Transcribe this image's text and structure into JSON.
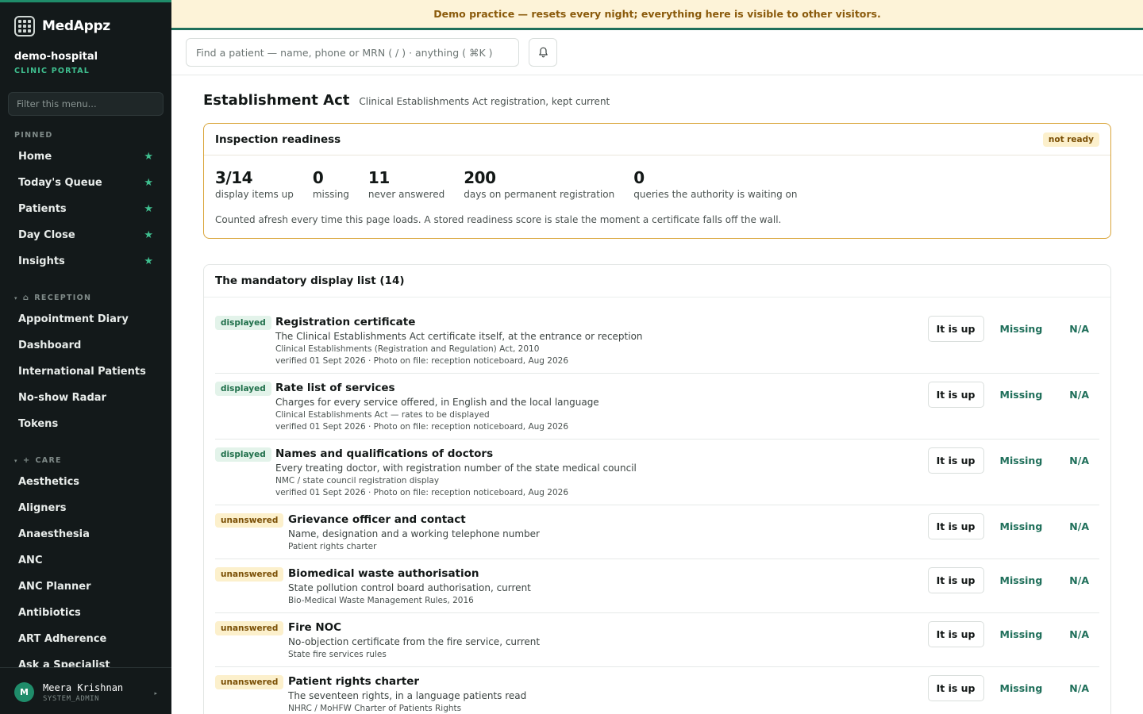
{
  "app": {
    "name": "MedAppz",
    "tenant": "demo-hospital",
    "portal": "CLINIC PORTAL"
  },
  "banner": "Demo practice — resets every night; everything here is visible to other visitors.",
  "sidebar": {
    "filter_placeholder": "Filter this menu...",
    "pinned_label": "PINNED",
    "pinned": [
      {
        "label": "Home"
      },
      {
        "label": "Today's Queue"
      },
      {
        "label": "Patients"
      },
      {
        "label": "Day Close"
      },
      {
        "label": "Insights"
      }
    ],
    "reception_label": "RECEPTION",
    "reception": [
      {
        "label": "Appointment Diary"
      },
      {
        "label": "Dashboard"
      },
      {
        "label": "International Patients"
      },
      {
        "label": "No-show Radar"
      },
      {
        "label": "Tokens"
      }
    ],
    "care_label": "CARE",
    "care": [
      {
        "label": "Aesthetics"
      },
      {
        "label": "Aligners"
      },
      {
        "label": "Anaesthesia"
      },
      {
        "label": "ANC"
      },
      {
        "label": "ANC Planner"
      },
      {
        "label": "Antibiotics"
      },
      {
        "label": "ART Adherence"
      },
      {
        "label": "Ask a Specialist"
      }
    ],
    "user": {
      "initial": "M",
      "name": "Meera Krishnan",
      "role": "SYSTEM_ADMIN"
    }
  },
  "topbar": {
    "search_placeholder": "Find a patient — name, phone or MRN ( / ) · anything ( ⌘K )"
  },
  "page": {
    "title": "Establishment Act",
    "subtitle": "Clinical Establishments Act registration, kept current"
  },
  "readiness": {
    "title": "Inspection readiness",
    "badge": "not ready",
    "stats": [
      {
        "value": "3/14",
        "label": "display items up"
      },
      {
        "value": "0",
        "label": "missing"
      },
      {
        "value": "11",
        "label": "never answered"
      },
      {
        "value": "200",
        "label": "days on permanent registration"
      },
      {
        "value": "0",
        "label": "queries the authority is waiting on"
      }
    ],
    "note": "Counted afresh every time this page loads. A stored readiness score is stale the moment a certificate falls off the wall."
  },
  "list": {
    "title": "The mandatory display list (14)",
    "actions": {
      "up": "It is up",
      "missing": "Missing",
      "na": "N/A"
    },
    "items": [
      {
        "status": "displayed",
        "title": "Registration certificate",
        "desc": "The Clinical Establishments Act certificate itself, at the entrance or reception",
        "law": "Clinical Establishments (Registration and Regulation) Act, 2010",
        "verified": "verified 01 Sept 2026 · Photo on file: reception noticeboard, Aug 2026"
      },
      {
        "status": "displayed",
        "title": "Rate list of services",
        "desc": "Charges for every service offered, in English and the local language",
        "law": "Clinical Establishments Act — rates to be displayed",
        "verified": "verified 01 Sept 2026 · Photo on file: reception noticeboard, Aug 2026"
      },
      {
        "status": "displayed",
        "title": "Names and qualifications of doctors",
        "desc": "Every treating doctor, with registration number of the state medical council",
        "law": "NMC / state council registration display",
        "verified": "verified 01 Sept 2026 · Photo on file: reception noticeboard, Aug 2026"
      },
      {
        "status": "unanswered",
        "title": "Grievance officer and contact",
        "desc": "Name, designation and a working telephone number",
        "law": "Patient rights charter",
        "verified": ""
      },
      {
        "status": "unanswered",
        "title": "Biomedical waste authorisation",
        "desc": "State pollution control board authorisation, current",
        "law": "Bio-Medical Waste Management Rules, 2016",
        "verified": ""
      },
      {
        "status": "unanswered",
        "title": "Fire NOC",
        "desc": "No-objection certificate from the fire service, current",
        "law": "State fire services rules",
        "verified": ""
      },
      {
        "status": "unanswered",
        "title": "Patient rights charter",
        "desc": "The seventeen rights, in a language patients read",
        "law": "NHRC / MoHFW Charter of Patients Rights",
        "verified": ""
      }
    ]
  }
}
